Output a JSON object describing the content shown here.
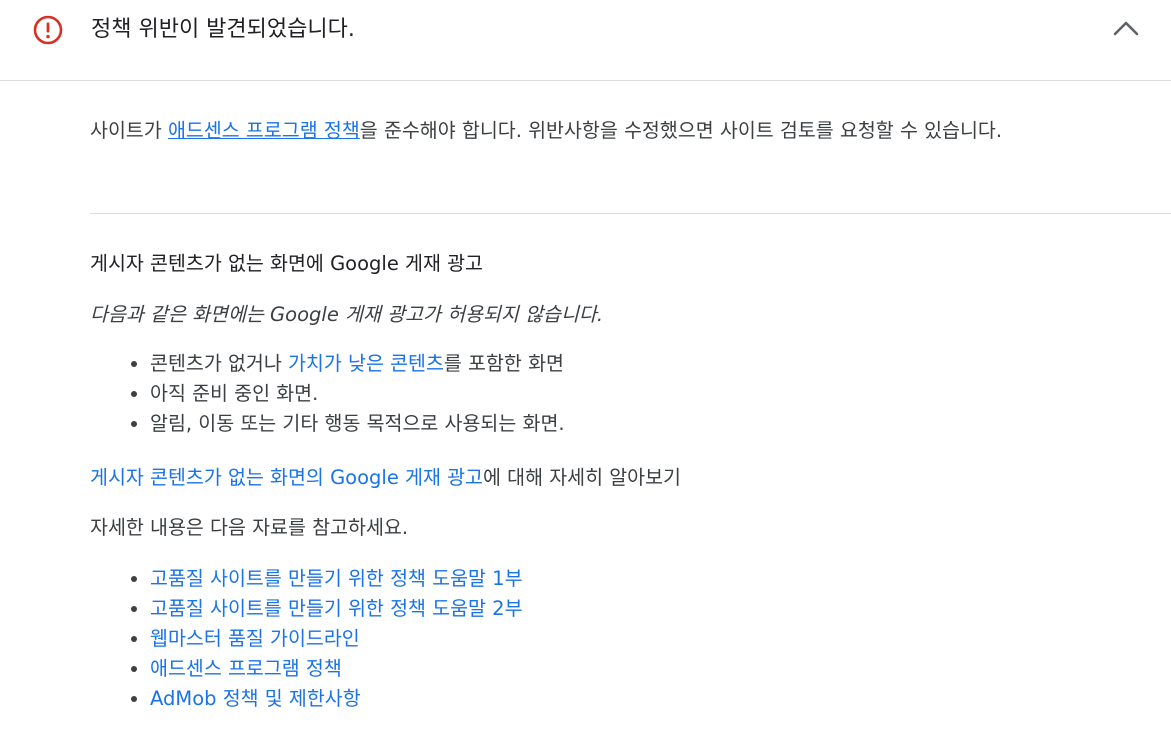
{
  "header": {
    "title": "정책 위반이 발견되었습니다.",
    "alert_icon": "error-circle-icon",
    "collapse_icon": "chevron-up-icon",
    "colors": {
      "alert": "#d93025",
      "text": "#202124"
    }
  },
  "intro": {
    "before": "사이트가 ",
    "link": "애드센스 프로그램 정책",
    "after": "을 준수해야 합니다. 위반사항을 수정했으면 사이트 검토를 요청할 수 있습니다."
  },
  "violation": {
    "title": "게시자 콘텐츠가 없는 화면에 Google 게재 광고",
    "description": "다음과 같은 화면에는 Google 게재 광고가 허용되지 않습니다.",
    "reasons": [
      {
        "before": "콘텐츠가 없거나 ",
        "link": "가치가 낮은 콘텐츠",
        "after": "를 포함한 화면"
      },
      {
        "text": "아직 준비 중인 화면."
      },
      {
        "text": "알림, 이동 또는 기타 행동 목적으로 사용되는 화면."
      }
    ],
    "learn_more": {
      "link": "게시자 콘텐츠가 없는 화면의 Google 게재 광고",
      "after": "에 대해 자세히 알아보기"
    }
  },
  "resources": {
    "intro": "자세한 내용은 다음 자료를 참고하세요.",
    "links": [
      "고품질 사이트를 만들기 위한 정책 도움말 1부",
      "고품질 사이트를 만들기 위한 정책 도움말 2부",
      "웹마스터 품질 가이드라인",
      "애드센스 프로그램 정책",
      "AdMob 정책 및 제한사항"
    ]
  },
  "colors": {
    "link": "#1a73e8",
    "divider": "#dadce0",
    "body_text": "#3c4043"
  }
}
